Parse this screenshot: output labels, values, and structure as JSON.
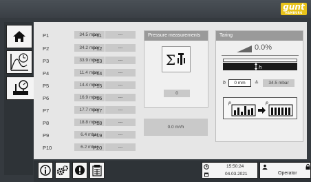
{
  "brand": {
    "logo_text": "gunt",
    "logo_sub": "HAMBURG"
  },
  "nav": [
    {
      "name": "home-icon"
    },
    {
      "name": "chart-timer-icon"
    },
    {
      "name": "pressure-gauge-icon"
    }
  ],
  "pressures_left": [
    {
      "label": "P1",
      "value": "34.5 mbar"
    },
    {
      "label": "P2",
      "value": "34.2 mbar"
    },
    {
      "label": "P3",
      "value": "33.9 mbar"
    },
    {
      "label": "P4",
      "value": "11.4 mbar"
    },
    {
      "label": "P5",
      "value": "14.4 mbar"
    },
    {
      "label": "P6",
      "value": "16.9 mbar"
    },
    {
      "label": "P7",
      "value": "17.7 mbar"
    },
    {
      "label": "P8",
      "value": "18.8 mbar"
    },
    {
      "label": "P9",
      "value": "6.4 mbar"
    },
    {
      "label": "P10",
      "value": "6.2 mbar"
    }
  ],
  "pressures_right": [
    {
      "label": "P11",
      "value": "---"
    },
    {
      "label": "P12",
      "value": "---"
    },
    {
      "label": "P13",
      "value": "---"
    },
    {
      "label": "P14",
      "value": "---"
    },
    {
      "label": "P15",
      "value": "---"
    },
    {
      "label": "P16",
      "value": "---"
    },
    {
      "label": "P17",
      "value": "---"
    },
    {
      "label": "P18",
      "value": "---"
    },
    {
      "label": "P19",
      "value": "---"
    },
    {
      "label": "P20",
      "value": "---"
    }
  ],
  "pressure_panel": {
    "title": "Pressure measurements",
    "count_value": "0",
    "flow_value": "0.0 m³/h"
  },
  "taring_panel": {
    "title": "Taring",
    "percent": "0.0%",
    "h_symbol": "h",
    "height_input": "0 mm",
    "equiv_symbol": "≙",
    "pressure_value": "34.5 mbar"
  },
  "bottom": {
    "buttons": [
      "info-icon",
      "settings-gears-icon",
      "alert-icon",
      "report-icon"
    ],
    "time": "15:50:24",
    "date": "04.03.2021",
    "user": "Operator"
  },
  "colors": {
    "background": "#353a3f",
    "panel": "#e6e6e6",
    "field": "#c9c9c9",
    "brand": "#e8c21a"
  }
}
